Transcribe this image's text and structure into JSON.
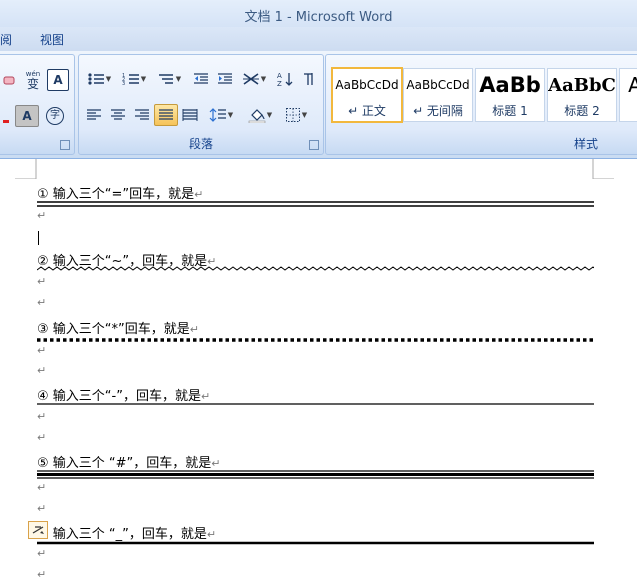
{
  "window": {
    "title": "文档 1 - Microsoft Word"
  },
  "menu": {
    "tabs": [
      "阅",
      "视图"
    ]
  },
  "ribbon": {
    "font_group": {
      "wen_label": "wén",
      "wen_char": "变",
      "border_char": "A",
      "shade_char": "A",
      "circle_char": "字"
    },
    "paragraph_group": {
      "label": "段落"
    },
    "styles_group": {
      "label": "样式",
      "items": [
        {
          "sample": "AaBbCcDd",
          "name": "↵ 正文",
          "active": true
        },
        {
          "sample": "AaBbCcDd",
          "name": "↵ 无间隔",
          "active": false
        },
        {
          "sample": "AaBb",
          "name": "标题 1",
          "active": false
        },
        {
          "sample": "AaBbC",
          "name": "标题 2",
          "active": false
        },
        {
          "sample": "A",
          "name": "",
          "active": false
        }
      ]
    }
  },
  "document": {
    "paragraph_mark": "↵",
    "paragraphs": [
      {
        "number": "①",
        "text": "输入三个“=”回车，就是",
        "border": "double"
      },
      {
        "number": "②",
        "text": "输入三个“~”，回车，就是",
        "border": "wavy"
      },
      {
        "number": "③",
        "text": "输入三个“*”回车，就是",
        "border": "dotted"
      },
      {
        "number": "④",
        "text": "输入三个“-”，回车，就是",
        "border": "single"
      },
      {
        "number": "⑤",
        "text": "输入三个 “#”，回车，就是",
        "border": "triple"
      },
      {
        "number": "⑥",
        "text": "输入三个 “_”，回车，就是",
        "border": "thick"
      }
    ]
  }
}
